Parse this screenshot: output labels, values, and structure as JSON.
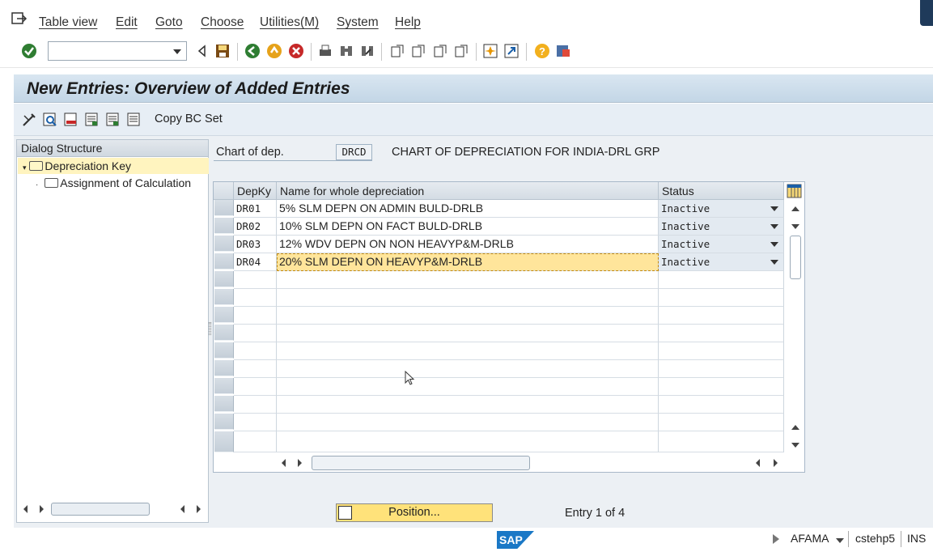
{
  "menu": {
    "items": [
      "Table view",
      "Edit",
      "Goto",
      "Choose",
      "Utilities(M)",
      "System",
      "Help"
    ]
  },
  "toolbar": {
    "command_field_value": "",
    "icons": [
      "enter-icon",
      "save-icon",
      "back-icon",
      "exit-icon",
      "cancel-icon",
      "print-icon",
      "find-icon",
      "find-next-icon",
      "first-page-icon",
      "previous-page-icon",
      "next-page-icon",
      "last-page-icon",
      "create-session-icon",
      "shortcut-icon",
      "help-icon",
      "customize-layout-icon"
    ]
  },
  "title": "New Entries: Overview of Added Entries",
  "app_toolbar": {
    "copy_bc_label": "Copy BC Set"
  },
  "dialog_structure": {
    "header": "Dialog Structure",
    "items": [
      {
        "label": "Depreciation Key",
        "selected": true
      },
      {
        "label": "Assignment of Calculation",
        "selected": false
      }
    ]
  },
  "chart": {
    "label": "Chart of dep.",
    "value": "DRCD",
    "description": "CHART OF DEPRECIATION FOR INDIA-DRL GRP"
  },
  "table": {
    "columns": [
      "DepKy",
      "Name for whole depreciation",
      "Status"
    ],
    "rows": [
      {
        "depky": "DR01",
        "name": "5% SLM DEPN ON ADMIN BULD-DRLB",
        "status": "Inactive"
      },
      {
        "depky": "DR02",
        "name": "10% SLM DEPN ON FACT BULD-DRLB",
        "status": "Inactive"
      },
      {
        "depky": "DR03",
        "name": "12% WDV DEPN ON NON HEAVYP&M-DRLB",
        "status": "Inactive"
      },
      {
        "depky": "DR04",
        "name": "20% SLM DEPN ON HEAVYP&M-DRLB",
        "status": "Inactive"
      }
    ]
  },
  "bottom": {
    "position_label": "Position...",
    "entry_info": "Entry 1 of 4"
  },
  "statusbar": {
    "logo": "SAP",
    "transaction": "AFAMA",
    "server": "cstehp5",
    "mode": "INS"
  }
}
